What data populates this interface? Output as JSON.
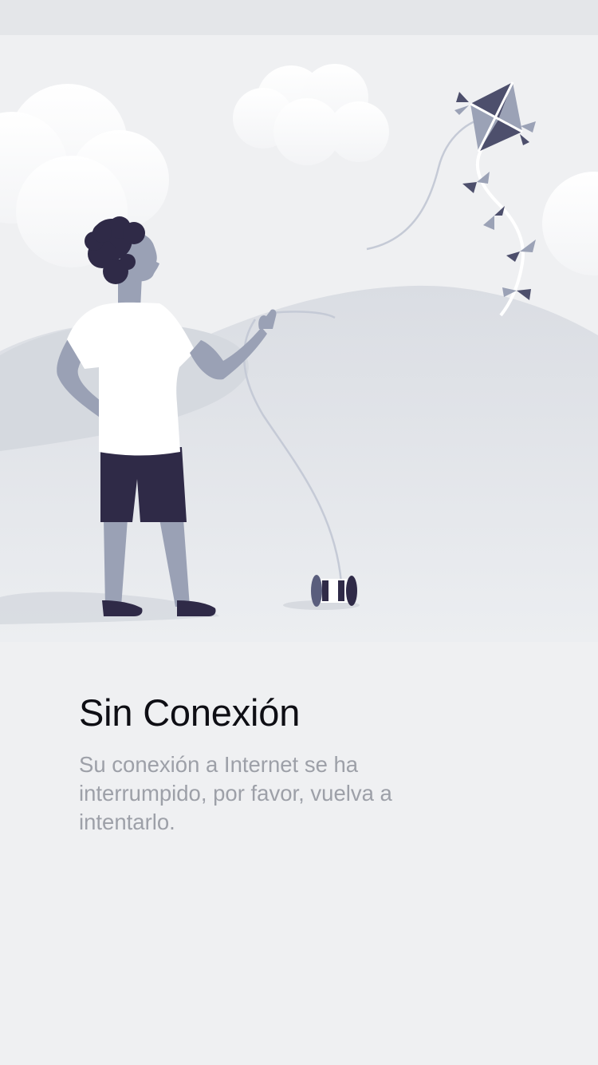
{
  "offline": {
    "title": "Sin Conexión",
    "message": "Su conexión a Internet se ha interrumpido, por favor, vuelva a intentarlo."
  },
  "illustration": {
    "icon": "offline-kite-illustration",
    "colors": {
      "background": "#eff0f2",
      "hill": "#dbdee3",
      "skin": "#9aa1b5",
      "hair": "#2f2a47",
      "shirt": "#ffffff",
      "shorts": "#2f2a47",
      "kite_dark": "#4d4f6c",
      "kite_light": "#9ba2b6",
      "string": "#c9cfd9"
    }
  }
}
